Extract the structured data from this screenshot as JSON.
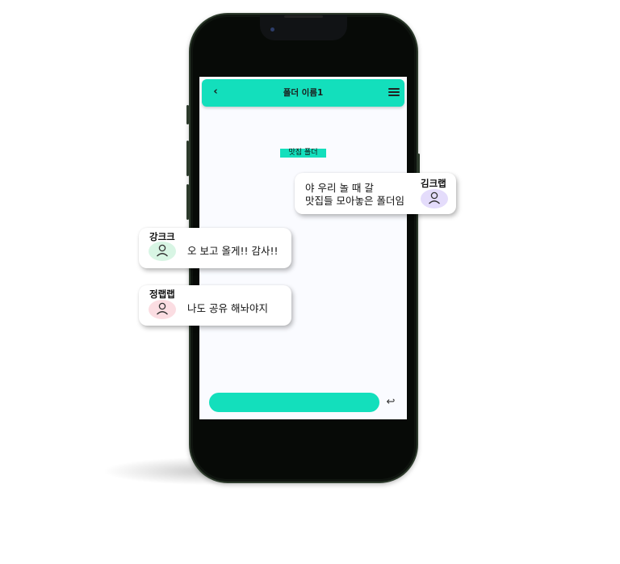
{
  "header": {
    "title": "폴더 이름1",
    "back_icon": "chevron-left-icon",
    "menu_icon": "hamburger-menu-icon"
  },
  "folder_tag": "맛집 폴더",
  "input": {
    "value": "",
    "send_icon": "return-arrow-icon"
  },
  "messages": [
    {
      "name": "김크랩",
      "lines": [
        "야 우리 놀 때 갈",
        "맛집들 모아놓은 폴더임"
      ],
      "avatar_color": "#e4dcfb"
    },
    {
      "name": "강크크",
      "text": "오 보고 올게!! 감사!!",
      "avatar_color": "#d8f5e4"
    },
    {
      "name": "정랩랩",
      "text": "나도 공유 해놔야지",
      "avatar_color": "#fbdde2"
    }
  ],
  "colors": {
    "accent": "#13dfbc",
    "phone_frame": "#2c3a2b",
    "screen_bg": "#fafbff"
  }
}
